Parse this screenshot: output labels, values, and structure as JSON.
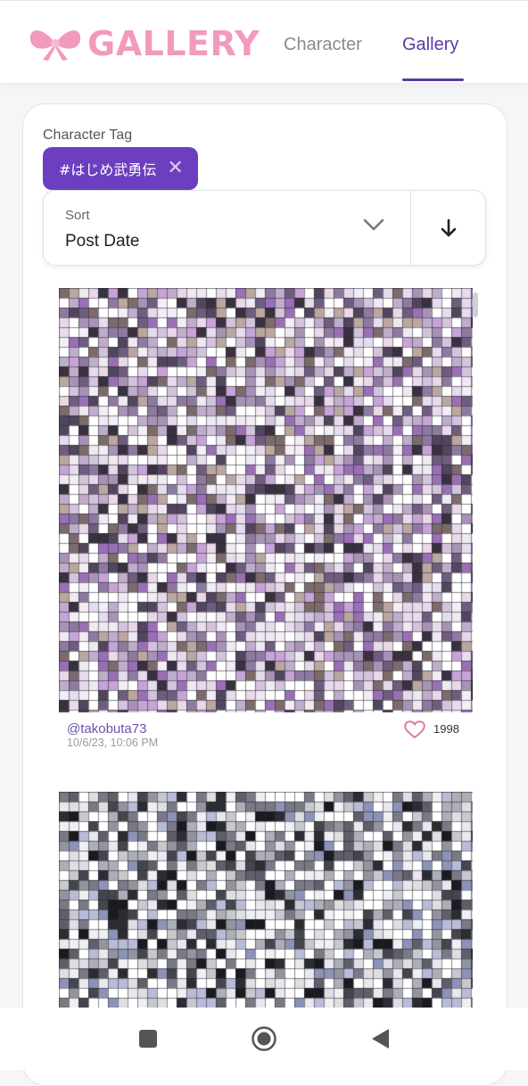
{
  "app": {
    "logo_text": "GALLERY",
    "brand_color": "#f19abd",
    "accent_color": "#5b3aa5"
  },
  "nav": {
    "tabs": [
      {
        "label": "Character",
        "active": false
      },
      {
        "label": "Gallery",
        "active": true
      }
    ]
  },
  "filters": {
    "character_tag_label": "Character Tag",
    "selected_tag": "#はじめ武勇伝",
    "sort_label": "Sort",
    "sort_value": "Post Date",
    "sort_direction": "descending"
  },
  "posts": [
    {
      "author": "@takobuta73",
      "date": "10/6/23, 10:06 PM",
      "likes": "1998",
      "image": "pixelated-artwork",
      "palette": "purple"
    },
    {
      "author": "",
      "date": "",
      "likes": "",
      "image": "pixelated-artwork",
      "palette": "grey"
    }
  ],
  "icons": {
    "logo": "ribbon-icon",
    "remove_tag": "close-icon",
    "sort_dropdown": "chevron-down-icon",
    "sort_direction": "arrow-down-icon",
    "like": "heart-icon",
    "system": [
      "square-icon",
      "circle-icon",
      "triangle-left-icon"
    ]
  }
}
